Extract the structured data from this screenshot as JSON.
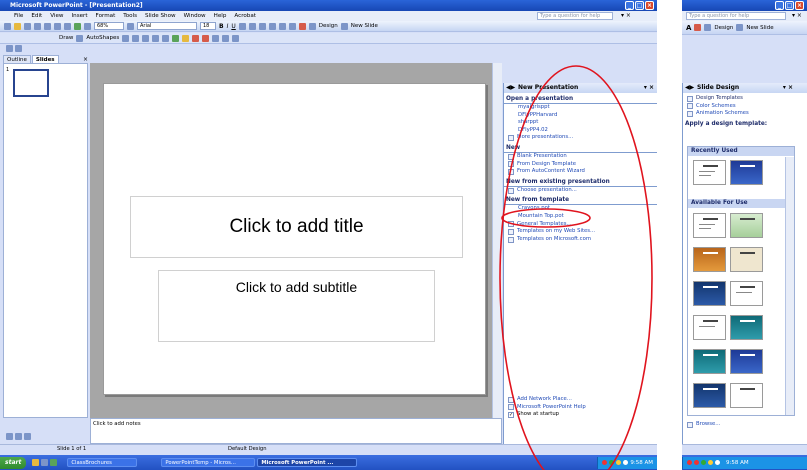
{
  "left": {
    "title": "Microsoft PowerPoint - [Presentation2]",
    "window_controls": [
      "_",
      "³",
      "×"
    ],
    "menu": [
      "File",
      "Edit",
      "View",
      "Insert",
      "Format",
      "Tools",
      "Slide Show",
      "Window",
      "Help",
      "Acrobat"
    ],
    "question_placeholder": "Type a question for help",
    "zoom": "68%",
    "font": "Arial",
    "font_size": "18",
    "toolbar_buttons": {
      "design": "Design",
      "new_slide": "New Slide",
      "draw": "Draw",
      "autoshapes": "AutoShapes"
    },
    "format_buttons": [
      "B",
      "I",
      "U"
    ],
    "tabs": [
      "Outline",
      "Slides"
    ],
    "slide_number": "1",
    "slide": {
      "title_placeholder": "Click to add title",
      "subtitle_placeholder": "Click to add subtitle"
    },
    "notes_placeholder": "Click to add notes",
    "status": {
      "slide": "Slide 1 of 1",
      "design": "Default Design"
    },
    "pane": {
      "title": "New Presentation",
      "sections": {
        "open": "Open a presentation",
        "new": "New",
        "existing": "New from existing presentation",
        "template": "New from template"
      },
      "open_items": [
        "myalgrisppt",
        "DFlyPPHarvard",
        "sharppt",
        "DFlyPP4.02"
      ],
      "more": "More presentations...",
      "new_items": [
        "Blank Presentation",
        "From Design Template",
        "From AutoContent Wizard"
      ],
      "existing_items": [
        "Choose presentation..."
      ],
      "template_items": [
        "Crayons.pot",
        "Mountain Top.pot",
        "General Templates...",
        "Templates on my Web Sites...",
        "Templates on Microsoft.com"
      ],
      "bottom_items": [
        "Add Network Place...",
        "Microsoft PowerPoint Help",
        "Show at startup"
      ]
    },
    "taskbar": {
      "start": "start",
      "buttons": [
        "ClassBrochures",
        "PowerPointTemp - Micros...",
        "Microsoft PowerPoint ..."
      ],
      "clock": "9:58 AM"
    }
  },
  "right": {
    "question_placeholder": "Type a question for help",
    "toolbar_buttons": {
      "design": "Design",
      "new_slide": "New Slide"
    },
    "pane": {
      "title": "Slide Design",
      "links": [
        "Design Templates",
        "Color Schemes",
        "Animation Schemes"
      ],
      "apply_label": "Apply a design template:",
      "groups": [
        "Recently Used",
        "Available For Use"
      ],
      "browse": "Browse..."
    },
    "clock": "9:58 AM"
  },
  "annotation": {
    "color": "#e0141e"
  }
}
